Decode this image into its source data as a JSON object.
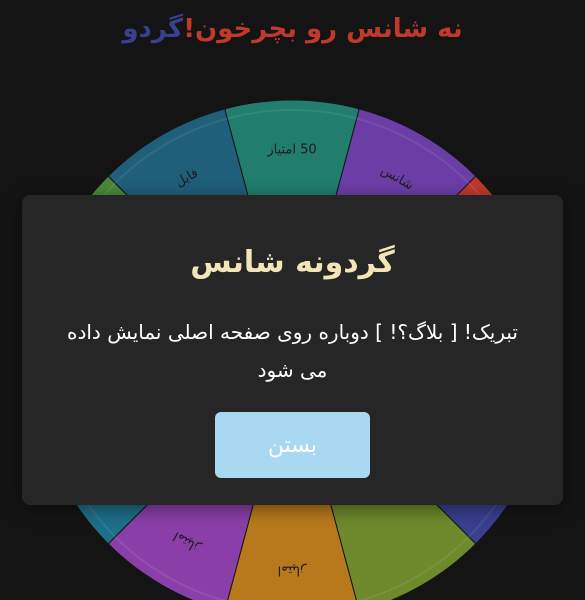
{
  "header": {
    "title_part_1": "گردو",
    "title_part_2": "نه شانس رو بچرخون!"
  },
  "wheel": {
    "segments": [
      {
        "label": "50 امتیاز",
        "color": "#217d6c"
      },
      {
        "label": "شانس",
        "color": "#6b3ea6"
      },
      {
        "label": "",
        "color": "#c0392b"
      },
      {
        "label": "",
        "color": "#d9a520"
      },
      {
        "label": "",
        "color": "#3a3f8f"
      },
      {
        "label": "",
        "color": "#6e8a2c"
      },
      {
        "label": "امتیاز",
        "color": "#b8791c"
      },
      {
        "label": "امتیاز",
        "color": "#8a3fa8"
      },
      {
        "label": "",
        "color": "#1e6f8a"
      },
      {
        "label": "",
        "color": "#c0392b"
      },
      {
        "label": "",
        "color": "#4a8a3a"
      },
      {
        "label": "فایل",
        "color": "#1f5f7a"
      }
    ]
  },
  "modal": {
    "title": "گردونه شانس",
    "message": "تبریک! [ بلاگ؟! ] دوباره روی صفحه اصلی نمایش داده می شود",
    "close_label": "بستن"
  }
}
